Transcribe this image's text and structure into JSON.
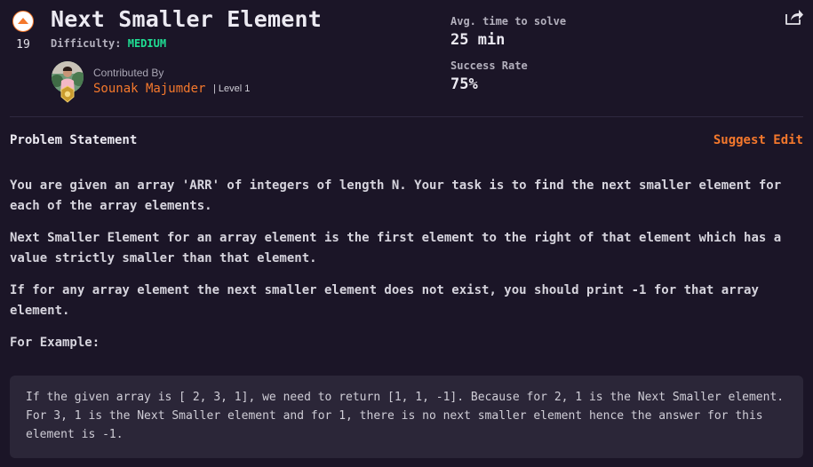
{
  "problem": {
    "upvotes": "19",
    "title": "Next Smaller Element",
    "difficulty_label": "Difficulty:",
    "difficulty_value": "MEDIUM"
  },
  "contributor": {
    "label": "Contributed By",
    "name": "Sounak Majumder",
    "level": "| Level 1"
  },
  "stats": {
    "avg_time_label": "Avg. time to solve",
    "avg_time_value": "25 min",
    "success_label": "Success Rate",
    "success_value": "75%"
  },
  "statement": {
    "heading": "Problem Statement",
    "suggest_edit": "Suggest Edit",
    "paragraphs": [
      "You are given an array 'ARR' of integers of length N. Your task is to find the next smaller element for each of the array elements.",
      "Next Smaller Element for an array element is the first element to the right of that element which has a value strictly smaller than that element.",
      "If for any array element the next smaller element does not exist, you should print -1 for that array element."
    ],
    "example_heading": "For Example:",
    "example_text": "If the given array is [ 2, 3, 1], we need to return [1, 1, -1]. Because for  2, 1 is the Next Smaller element. For 3, 1 is the Next Smaller element and for 1, there is no next smaller element hence the answer for this element is -1."
  },
  "colors": {
    "accent": "#f4782c",
    "difficulty_medium": "#1fdd93",
    "background": "#1b1527",
    "example_bg": "#2b2638"
  },
  "icons": {
    "upvote": "upvote-arrow-icon",
    "share": "share-icon",
    "badge": "level-badge-icon"
  }
}
